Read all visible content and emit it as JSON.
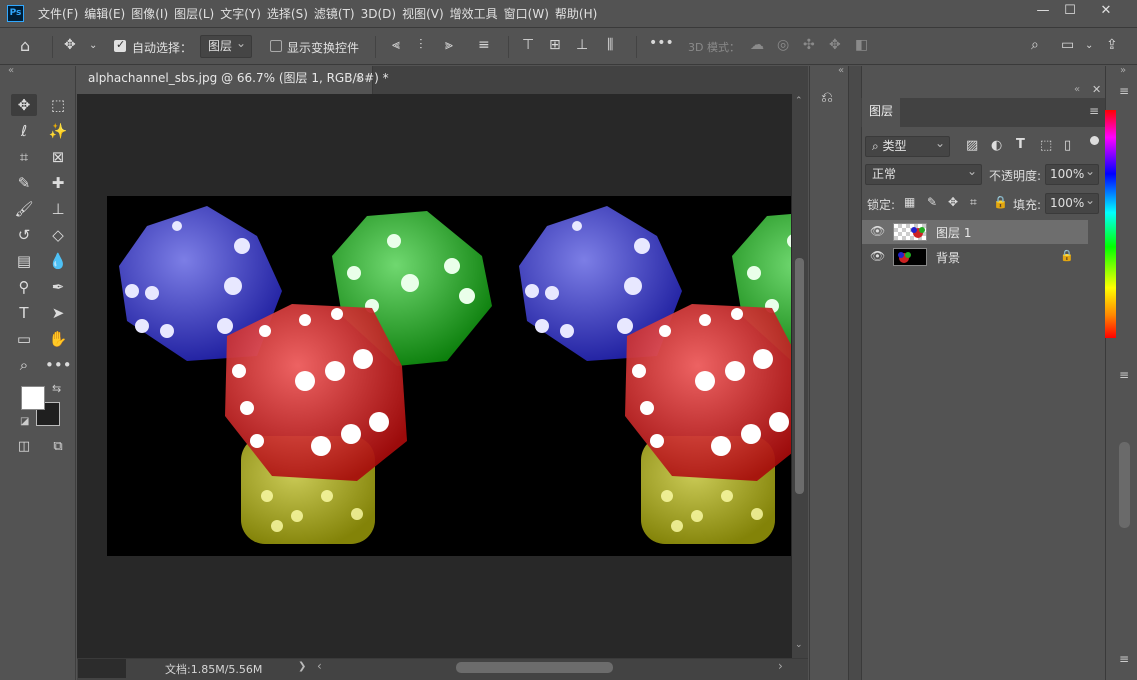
{
  "app": {
    "logo_text": "Ps",
    "menu": [
      "文件(F)",
      "编辑(E)",
      "图像(I)",
      "图层(L)",
      "文字(Y)",
      "选择(S)",
      "滤镜(T)",
      "3D(D)",
      "视图(V)",
      "增效工具",
      "窗口(W)",
      "帮助(H)"
    ],
    "window_controls": [
      "minimize-icon",
      "maximize-icon",
      "close-icon"
    ]
  },
  "options_bar": {
    "auto_select_label": "自动选择：",
    "auto_select_checked": true,
    "auto_select_target": "图层",
    "show_transform_label": "显示变换控件",
    "show_transform_checked": false,
    "mode_3d_label": "3D 模式："
  },
  "document": {
    "tab_title": "alphachannel_sbs.jpg @ 66.7% (图层 1, RGB/8#) *",
    "tab_close": "×",
    "status_doc": "文档:1.85M/5.56M",
    "status_arrow": "❯",
    "scroll_left": "‹",
    "scroll_right": "›"
  },
  "layers_panel": {
    "tab_label": "图层",
    "filter_kind": "类型",
    "blend_mode": "正常",
    "opacity_label": "不透明度:",
    "opacity_value": "100%",
    "lock_label": "锁定:",
    "fill_label": "填充:",
    "fill_value": "100%",
    "layers": [
      {
        "name": "图层 1",
        "visible": true,
        "selected": true,
        "locked": false
      },
      {
        "name": "背景",
        "visible": true,
        "selected": false,
        "locked": true
      }
    ]
  },
  "colors": {
    "foreground": "#ffffff",
    "background": "#1f1f1f",
    "ui_base": "#535353",
    "canvas_bg": "#282828"
  }
}
